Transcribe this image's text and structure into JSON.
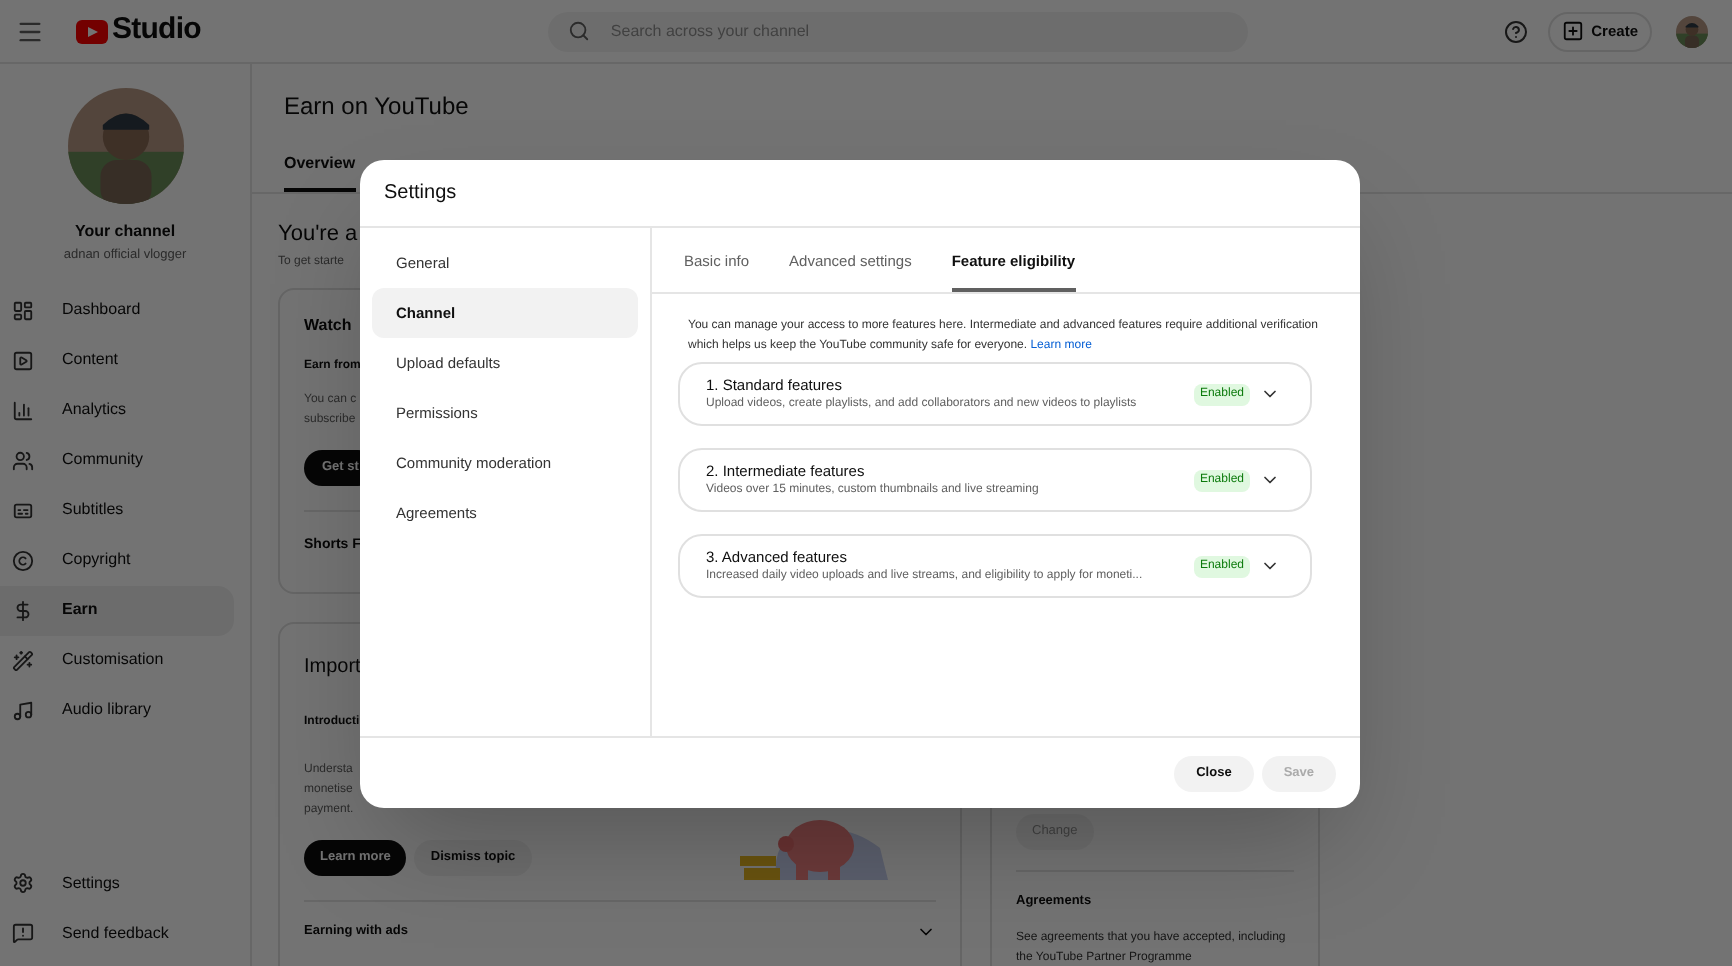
{
  "header": {
    "logo": "Studio",
    "search": {
      "placeholder": "Search across your channel"
    },
    "create": "Create"
  },
  "sidebar": {
    "channel_title": "Your channel",
    "channel_name": "adnan official vlogger",
    "items": [
      {
        "label": "Dashboard",
        "selected": false
      },
      {
        "label": "Content",
        "selected": false
      },
      {
        "label": "Analytics",
        "selected": false
      },
      {
        "label": "Community",
        "selected": false
      },
      {
        "label": "Subtitles",
        "selected": false
      },
      {
        "label": "Copyright",
        "selected": false
      },
      {
        "label": "Earn",
        "selected": true
      },
      {
        "label": "Customisation",
        "selected": false
      },
      {
        "label": "Audio library",
        "selected": false
      }
    ],
    "footer_items": [
      {
        "label": "Settings"
      },
      {
        "label": "Send feedback"
      }
    ]
  },
  "page": {
    "title": "Earn on YouTube",
    "tabs": [
      {
        "label": "Overview",
        "selected": true
      }
    ],
    "heading": "You're a",
    "subheading": "To get starte",
    "card_1": {
      "title": "Watch",
      "subtitle": "Earn from",
      "body": [
        "You can c",
        "subscribe"
      ],
      "button": "Get st",
      "row": "Shorts F"
    },
    "card_2": {
      "title": "Import",
      "subtitle": "Introducti",
      "body": [
        "Understa",
        "monetise",
        "payment."
      ],
      "primary_button": "Learn more",
      "secondary_button": "Dismiss topic",
      "row": "Earning with ads"
    },
    "side_card": {
      "button": "Change",
      "title": "Agreements",
      "body": "See agreements that you have accepted, including the YouTube Partner Programme"
    }
  },
  "dialog": {
    "title": "Settings",
    "nav": [
      {
        "label": "General",
        "selected": false
      },
      {
        "label": "Channel",
        "selected": true
      },
      {
        "label": "Upload defaults",
        "selected": false
      },
      {
        "label": "Permissions",
        "selected": false
      },
      {
        "label": "Community moderation",
        "selected": false
      },
      {
        "label": "Agreements",
        "selected": false
      }
    ],
    "tabs": [
      {
        "label": "Basic info",
        "selected": false
      },
      {
        "label": "Advanced settings",
        "selected": false
      },
      {
        "label": "Feature eligibility",
        "selected": true
      }
    ],
    "intro": "You can manage your access to more features here. Intermediate and advanced features require additional verification which helps us keep the YouTube community safe for everyone.",
    "intro_link": "Learn more",
    "features": [
      {
        "title": "1. Standard features",
        "description": "Upload videos, create playlists, and add collaborators and new videos to playlists",
        "status": "Enabled",
        "enabled": true
      },
      {
        "title": "2. Intermediate features",
        "description": "Videos over 15 minutes, custom thumbnails and live streaming",
        "status": "Enabled",
        "enabled": true
      },
      {
        "title": "3. Advanced features",
        "description": "Increased daily video uploads and live streams, and eligibility to apply for moneti...",
        "status": "Enabled",
        "enabled": true
      }
    ],
    "buttons": [
      {
        "label": "Close",
        "disabled": false
      },
      {
        "label": "Save",
        "disabled": true
      }
    ]
  }
}
